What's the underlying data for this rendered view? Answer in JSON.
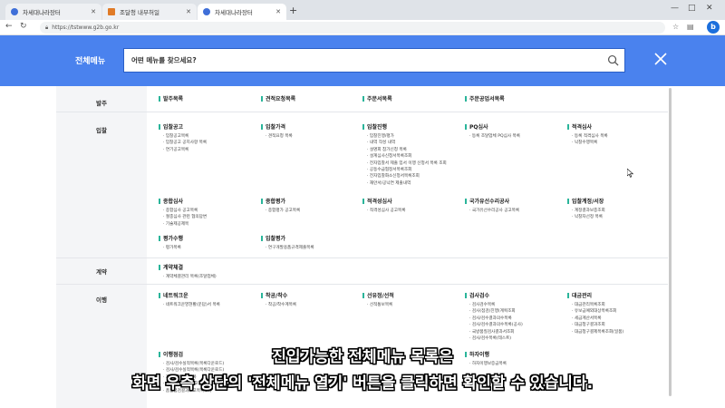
{
  "browser": {
    "tabs": [
      {
        "label": "차세대나라장터",
        "favicon": "blue"
      },
      {
        "label": "조달청 내부허일",
        "favicon": "orange"
      },
      {
        "label": "차세대나라장터",
        "favicon": "blue"
      }
    ],
    "new_tab": "+",
    "url": "https://tstwww.g2b.go.kr",
    "window_controls": [
      "—",
      "□",
      "✕"
    ]
  },
  "header": {
    "title": "전체메뉴",
    "search_placeholder": "어떤 메뉴를 찾으세요?",
    "accent_color": "#4a82ee"
  },
  "menu": [
    {
      "category": "발주",
      "groups": [
        {
          "title": "발주목록",
          "items": []
        },
        {
          "title": "견적요청목록",
          "items": []
        },
        {
          "title": "주문서목록",
          "items": []
        },
        {
          "title": "주문공업서목록",
          "items": []
        }
      ]
    },
    {
      "category": "입찰",
      "groups": [
        {
          "title": "입찰공고",
          "items": [
            "입찰공고목록",
            "입찰공고 공지사항 목록",
            "연기공고목록"
          ]
        },
        {
          "title": "입찰가격",
          "items": [
            "견적요청 목록"
          ]
        },
        {
          "title": "입찰진행",
          "items": [
            "입찰진행/평가",
            "내역 작성 내역",
            "설명회 참가신청 목록",
            "설계심사신청서목록조회",
            "전자입찰서 제출 입서 이행 신청서 목록 조회",
            "공동수급협정서목록조회",
            "전자입찰화소신청서목록조회",
            "재안서/공낙연 제출내역"
          ]
        },
        {
          "title": "PQ심사",
          "items": [
            "등록 조달업체 PQ심사 목록"
          ]
        },
        {
          "title": "적격심사",
          "items": [
            "등록 적격심사 목록",
            "낙찰수행목록"
          ]
        },
        {
          "title": "종합심사",
          "items": [
            "종합심사 공고목록",
            "절충심사 관련 협의답변",
            "기술제공제목"
          ]
        },
        {
          "title": "종합평가",
          "items": [
            "종합평가 공고목록"
          ]
        },
        {
          "title": "적격성심사",
          "items": [
            "적격성심사 공고목록"
          ]
        },
        {
          "title": "국가유선수리공사",
          "items": [
            "국가유선수리공사 공고목록"
          ]
        },
        {
          "title": "입찰계정/서장",
          "items": [
            "계정결과보충조회",
            "낙찰자선정 목록"
          ]
        },
        {
          "title": "평가수행",
          "items": [
            "평가목록"
          ]
        },
        {
          "title": "입찰평가",
          "items": [
            "연구개발용품규격제출목록"
          ]
        }
      ]
    },
    {
      "category": "계약",
      "groups": [
        {
          "title": "계약체결",
          "items": [
            "계약체결관리 목록(조달업체)"
          ]
        }
      ]
    },
    {
      "category": "이행",
      "groups": [
        {
          "title": "네트워크운",
          "items": [
            "네트워크운영현황(문답)서 목록"
          ]
        },
        {
          "title": "착공/착수",
          "items": [
            "착공/착수계목록"
          ]
        },
        {
          "title": "선유정/선적",
          "items": [
            "선적통보목록"
          ]
        },
        {
          "title": "검사검수",
          "items": [
            "검사검수목록",
            "검사(점검)진행(계획조회",
            "검사/검수결과의수목록",
            "검사/검수결과의수목록(공사)",
            "국방품질검사결과서조회",
            "검사/검수목록(테스트)"
          ]
        },
        {
          "title": "대금관리",
          "items": [
            "대금관리목록조회",
            "유보금예외대상목록조회",
            "세금계산서목록",
            "대금청구결과조회",
            "대금청구결제목록조회(일품)"
          ]
        },
        {
          "title": "이행점검",
          "items": [
            "검사/검수실적목록(목록다운로드)",
            "검사/검수실적목록(목록다운로드)",
            "계약이행점검목록",
            "품질점검결과(보고)목록",
            "품질점검결과보고목록조회"
          ]
        },
        {
          "title": "하자이행",
          "items": [
            "하자이행보증금목록"
          ]
        }
      ]
    }
  ],
  "subtitles": {
    "line1": "진입가능한 전체메뉴 목록은",
    "line2": "화면 우측 상단의 '전체메뉴 열기' 버튼을 클릭하면 확인할 수 있습니다."
  }
}
